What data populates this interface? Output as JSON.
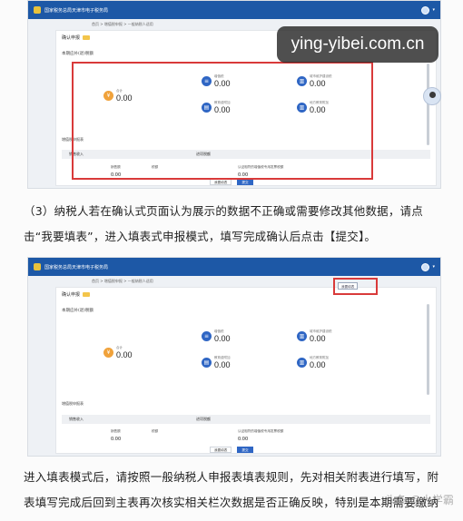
{
  "screenshot1": {
    "site_title": "国家税务总局天津市电子税务局",
    "breadcrumb": "首页 > 增值税申报 > 一般纳税人适用",
    "panel_title": "确认申报",
    "summary_title": "本期应补(退)税额",
    "stats": [
      {
        "label": "合计",
        "value": "0.00",
        "icon": "coin-icon"
      },
      {
        "label": "增值税",
        "value": "0.00",
        "icon": "tax-icon"
      },
      {
        "label": "城市维护建设税",
        "value": "0.00",
        "icon": "building-icon"
      },
      {
        "label": "教育费附加",
        "value": "0.00",
        "icon": "book-icon"
      },
      {
        "label": "地方教育附加",
        "value": "0.00",
        "icon": "building-icon"
      }
    ],
    "section_title": "增值税申报表",
    "table_left_header": "销售收入",
    "table_right_header": "进项税额",
    "left_label": "销售额",
    "left_label2": "税额",
    "left_value": "0.00",
    "right_label": "认证相符的增值税专用发票税额",
    "right_value": "0.00",
    "buttons": [
      "我要填表",
      "提交"
    ]
  },
  "paragraph1": "（3）纳税人若在确认式页面认为展示的数据不正确或需要修改其他数据，请点击“我要填表”，进入填表式申报模式，填写完成确认后点击【提交】。",
  "screenshot2": {
    "site_title": "国家税务总局天津市电子税务局",
    "breadcrumb": "首页 > 增值税申报 > 一般纳税人适用",
    "panel_title": "确认申报",
    "edit_button": "我要填表",
    "summary_title": "本期应补(退)税额",
    "stats": [
      {
        "label": "合计",
        "value": "0.00",
        "icon": "coin-icon"
      },
      {
        "label": "增值税",
        "value": "0.00",
        "icon": "tax-icon"
      },
      {
        "label": "城市维护建设税",
        "value": "0.00",
        "icon": "building-icon"
      },
      {
        "label": "教育费附加",
        "value": "0.00",
        "icon": "book-icon"
      },
      {
        "label": "地方教育附加",
        "value": "0.00",
        "icon": "building-icon"
      }
    ],
    "section_title": "增值税申报表",
    "table_left_header": "销售收入",
    "table_right_header": "进项税额",
    "left_label": "销售额",
    "left_label2": "税额",
    "left_value": "0.00",
    "right_label": "认证相符的增值税专用发票税额",
    "right_value": "0.00",
    "buttons": [
      "我要填表",
      "提交"
    ]
  },
  "paragraph2": "进入填表模式后，请按照一般纳税人申报表填表规则，先对相关附表进行填写，附表填写完成后回到主表再次核实相关栏次数据是否正确反映，特别是本期需要缴纳的税费",
  "watermark": {
    "banner": "ying-yibei.com.cn",
    "corner": "头条 @大学霸"
  },
  "colors": {
    "topbar": "#1d58a6",
    "highlight": "#d93a3a",
    "primary": "#2f66c4"
  }
}
